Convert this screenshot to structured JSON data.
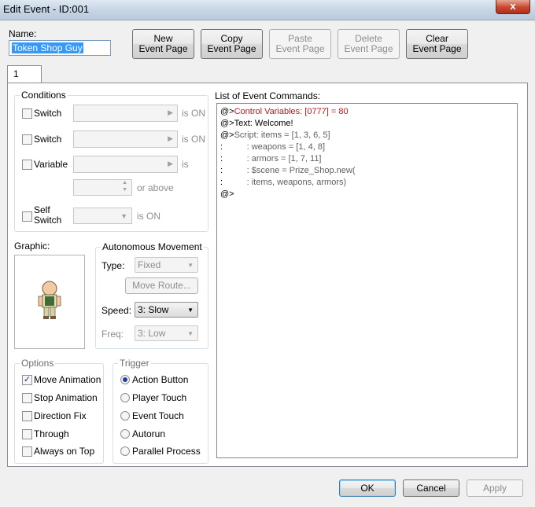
{
  "window": {
    "title": "Edit Event - ID:001",
    "close_glyph": "x"
  },
  "name": {
    "label": "Name:",
    "value": "Token Shop Guy"
  },
  "toolbar": {
    "new_page": "New\nEvent Page",
    "copy_page": "Copy\nEvent Page",
    "paste_page": "Paste\nEvent Page",
    "delete_page": "Delete\nEvent Page",
    "clear_page": "Clear\nEvent Page"
  },
  "tabs": [
    {
      "label": "1"
    }
  ],
  "conditions": {
    "title": "Conditions",
    "switch1": {
      "label": "Switch",
      "suffix": "is ON"
    },
    "switch2": {
      "label": "Switch",
      "suffix": "is ON"
    },
    "variable": {
      "label": "Variable",
      "suffix": "is",
      "or_above": "or above"
    },
    "self_switch": {
      "label": "Self\nSwitch",
      "suffix": "is ON"
    }
  },
  "graphic": {
    "label": "Graphic:"
  },
  "autonomous": {
    "title": "Autonomous Movement",
    "type_label": "Type:",
    "type_value": "Fixed",
    "move_route": "Move Route...",
    "speed_label": "Speed:",
    "speed_value": "3: Slow",
    "freq_label": "Freq:",
    "freq_value": "3: Low"
  },
  "options": {
    "title": "Options",
    "items": [
      {
        "label": "Move Animation",
        "checked": true
      },
      {
        "label": "Stop Animation",
        "checked": false
      },
      {
        "label": "Direction Fix",
        "checked": false
      },
      {
        "label": "Through",
        "checked": false
      },
      {
        "label": "Always on Top",
        "checked": false
      }
    ]
  },
  "trigger": {
    "title": "Trigger",
    "items": [
      {
        "label": "Action Button",
        "selected": true
      },
      {
        "label": "Player Touch",
        "selected": false
      },
      {
        "label": "Event Touch",
        "selected": false
      },
      {
        "label": "Autorun",
        "selected": false
      },
      {
        "label": "Parallel Process",
        "selected": false
      }
    ]
  },
  "commands": {
    "label": "List of Event Commands:",
    "lines": [
      {
        "prefix": "@>",
        "text": "Control Variables: [0777] = 80",
        "color": "#c0181b"
      },
      {
        "prefix": "@>",
        "text": "Text: Welcome!",
        "color": "#000000"
      },
      {
        "prefix": "@>",
        "text": "Script: items = [1, 3, 6, 5]",
        "color": "#5f5f5f"
      },
      {
        "prefix": " :",
        "text": "          : weapons = [1, 4, 8]",
        "color": "#5f5f5f"
      },
      {
        "prefix": " :",
        "text": "          : armors = [1, 7, 11]",
        "color": "#5f5f5f"
      },
      {
        "prefix": " :",
        "text": "          : $scene = Prize_Shop.new(",
        "color": "#5f5f5f"
      },
      {
        "prefix": " :",
        "text": "          : items, weapons, armors)",
        "color": "#5f5f5f"
      },
      {
        "prefix": "@>",
        "text": "",
        "color": "#000000"
      }
    ]
  },
  "footer": {
    "ok": "OK",
    "cancel": "Cancel",
    "apply": "Apply"
  }
}
